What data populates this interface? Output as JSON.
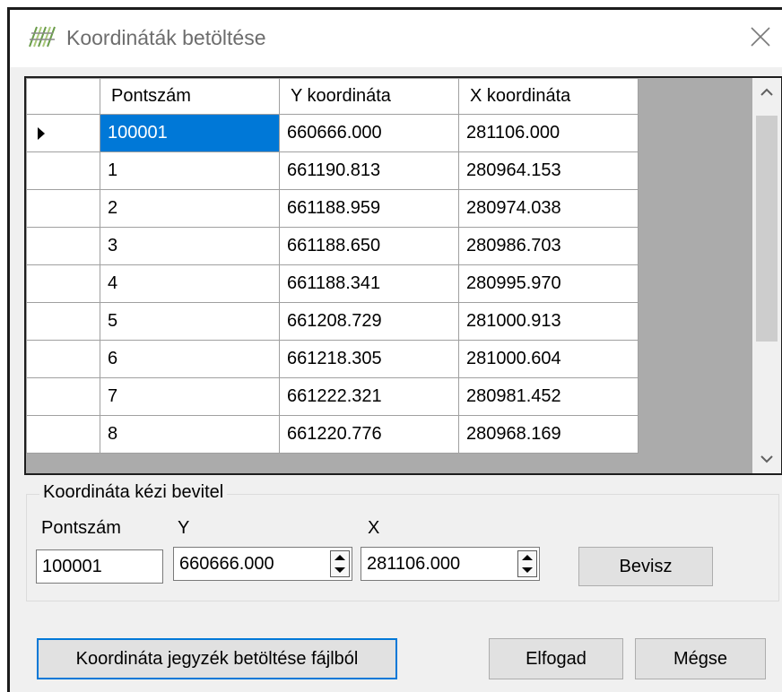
{
  "window": {
    "title": "Koordináták betöltése",
    "icon": "map-icon",
    "close_icon": "close-icon"
  },
  "grid": {
    "columns": [
      "Pontszám",
      "Y koordináta",
      "X koordináta"
    ],
    "rows": [
      [
        "100001",
        "660666.000",
        "281106.000"
      ],
      [
        "1",
        "661190.813",
        "280964.153"
      ],
      [
        "2",
        "661188.959",
        "280974.038"
      ],
      [
        "3",
        "661188.650",
        "280986.703"
      ],
      [
        "4",
        "661188.341",
        "280995.970"
      ],
      [
        "5",
        "661208.729",
        "281000.913"
      ],
      [
        "6",
        "661218.305",
        "281000.604"
      ],
      [
        "7",
        "661222.321",
        "280981.452"
      ],
      [
        "8",
        "661220.776",
        "280968.169"
      ]
    ],
    "selected_row": 0,
    "selected_col": 0,
    "scroll_icons": [
      "chevron-up-icon",
      "chevron-down-icon"
    ]
  },
  "manual_entry": {
    "legend": "Koordináta kézi bevitel",
    "point_label": "Pontszám",
    "point_value": "100001",
    "y_label": "Y",
    "y_value": "660666.000",
    "x_label": "X",
    "x_value": "281106.000",
    "submit_label": "Bevisz"
  },
  "footer": {
    "load_file_label": "Koordináta jegyzék betöltése fájlból",
    "accept_label": "Elfogad",
    "cancel_label": "Mégse"
  },
  "colors": {
    "selection": "#0078d7",
    "grid_background": "#ababab",
    "window": "#f0f0f0"
  }
}
